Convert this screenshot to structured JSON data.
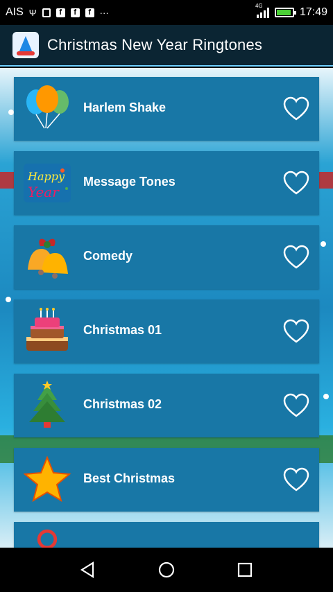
{
  "status_bar": {
    "carrier": "AIS",
    "network": "4G",
    "time": "17:49",
    "battery_level": 0.9
  },
  "app": {
    "title": "Christmas New Year Ringtones"
  },
  "list": {
    "items": [
      {
        "label": "Harlem Shake",
        "icon": "balloons-icon"
      },
      {
        "label": "Message Tones",
        "icon": "happy-new-year-icon"
      },
      {
        "label": "Comedy",
        "icon": "bells-icon"
      },
      {
        "label": "Christmas 01",
        "icon": "cake-icon"
      },
      {
        "label": "Christmas 02",
        "icon": "christmas-tree-icon"
      },
      {
        "label": "Best Christmas",
        "icon": "star-icon"
      }
    ]
  },
  "colors": {
    "app_bar": "#0b2533",
    "item_bg": "#1877a6",
    "accent": "#6fd0ff"
  }
}
